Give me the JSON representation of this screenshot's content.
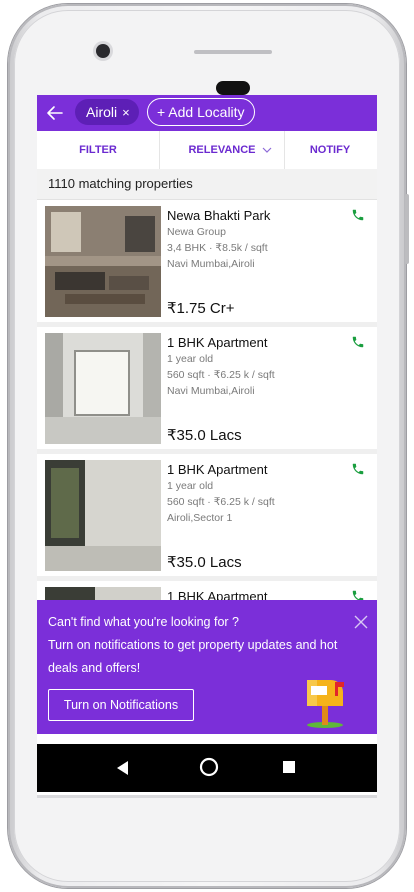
{
  "header": {
    "back_icon": "arrow-left-icon",
    "locality_chip": "Airoli",
    "chip_close": "×",
    "add_locality": "+ Add Locality"
  },
  "tabs": [
    {
      "label": "FILTER"
    },
    {
      "label": "RELEVANCE"
    },
    {
      "label": "NOTIFY"
    }
  ],
  "results": {
    "count_text": "1110 matching properties"
  },
  "listings": [
    {
      "title": "Newa Bhakti Park",
      "line1": "Newa Group",
      "line2": "3,4 BHK · ₹8.5k / sqft",
      "line3": "Navi Mumbai,Airoli",
      "price": "₹1.75 Cr+"
    },
    {
      "title": "1 BHK Apartment",
      "line1": "1 year old",
      "line2": "560 sqft · ₹6.25 k / sqft",
      "line3": "Navi Mumbai,Airoli",
      "price": "₹35.0 Lacs"
    },
    {
      "title": "1 BHK Apartment",
      "line1": "1 year old",
      "line2": "560 sqft · ₹6.25 k / sqft",
      "line3": "Airoli,Sector 1",
      "price": "₹35.0 Lacs"
    },
    {
      "title": "1 BHK Apartment"
    }
  ],
  "banner": {
    "line1": "Can't find what you're looking for ?",
    "line2": "Turn on notifications to get property updates and hot",
    "line3": "deals and offers!",
    "button": "Turn on Notifications"
  },
  "colors": {
    "primary": "#7b2fd9",
    "call_green": "#1a9e3f",
    "mailbox_yellow": "#f5b31a"
  }
}
